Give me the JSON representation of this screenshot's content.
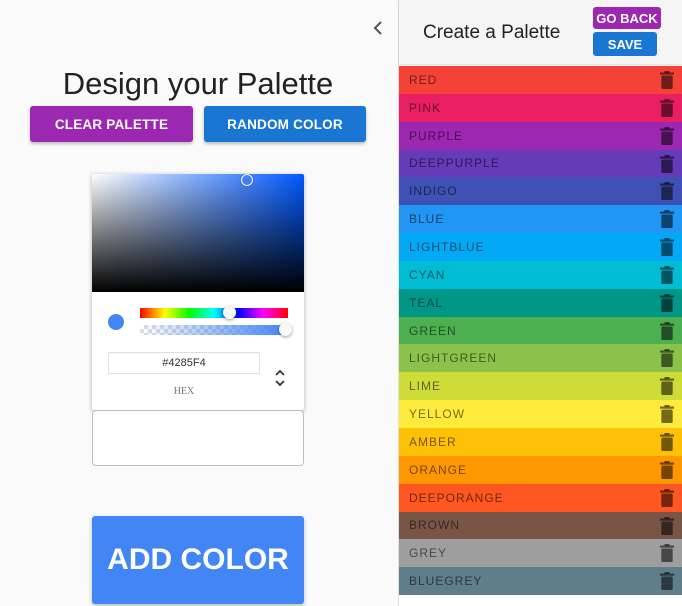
{
  "designer": {
    "title": "Design your Palette",
    "clear_label": "CLEAR PALETTE",
    "random_label": "RANDOM COLOR",
    "add_label": "ADD COLOR",
    "collapse_icon": "chevron-left-icon"
  },
  "picker": {
    "hex_value": "#4285F4",
    "hex_label": "HEX",
    "current_color": "#4285f4"
  },
  "sidebar": {
    "title": "Create a Palette",
    "goback_label": "GO BACK",
    "save_label": "SAVE",
    "colors": [
      {
        "name": "RED",
        "color": "#f44336"
      },
      {
        "name": "PINK",
        "color": "#e91e63"
      },
      {
        "name": "PURPLE",
        "color": "#9c27b0"
      },
      {
        "name": "DEEPPURPLE",
        "color": "#673ab7"
      },
      {
        "name": "INDIGO",
        "color": "#3f51b5"
      },
      {
        "name": "BLUE",
        "color": "#2196f3"
      },
      {
        "name": "LIGHTBLUE",
        "color": "#03a9f4"
      },
      {
        "name": "CYAN",
        "color": "#00bcd4"
      },
      {
        "name": "TEAL",
        "color": "#009688"
      },
      {
        "name": "GREEN",
        "color": "#4caf50"
      },
      {
        "name": "LIGHTGREEN",
        "color": "#8bc34a"
      },
      {
        "name": "LIME",
        "color": "#cddc39"
      },
      {
        "name": "YELLOW",
        "color": "#ffeb3b"
      },
      {
        "name": "AMBER",
        "color": "#ffc107"
      },
      {
        "name": "ORANGE",
        "color": "#ff9800"
      },
      {
        "name": "DEEPORANGE",
        "color": "#ff5722"
      },
      {
        "name": "BROWN",
        "color": "#795548"
      },
      {
        "name": "GREY",
        "color": "#9e9e9e"
      },
      {
        "name": "BLUEGREY",
        "color": "#607d8b"
      }
    ]
  }
}
